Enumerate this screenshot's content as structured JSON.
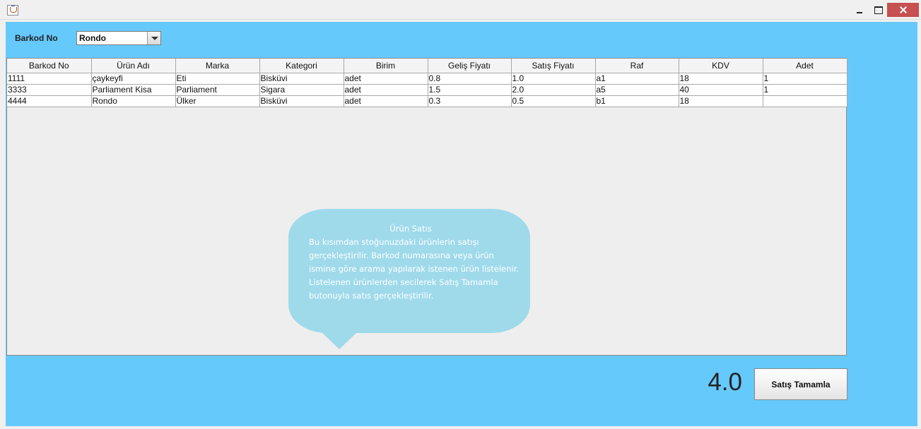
{
  "window": {
    "icon": "java-coffee-icon",
    "controls": [
      "minimize-icon",
      "maximize-icon",
      "close-icon"
    ]
  },
  "filter": {
    "label": "Barkod No",
    "selected": "Rondo"
  },
  "table": {
    "headers": [
      "Barkod No",
      "Ürün Adı",
      "Marka",
      "Kategori",
      "Birim",
      "Geliş Fiyatı",
      "Satış Fiyatı",
      "Raf",
      "KDV",
      "Adet"
    ],
    "rows": [
      [
        "1111",
        "çaykeyfi",
        "Eti",
        "Bisküvi",
        "adet",
        "0.8",
        "1.0",
        "a1",
        "18",
        "1"
      ],
      [
        "3333",
        "Parliament Kisa",
        "Parliament",
        "Sigara",
        "adet",
        "1.5",
        "2.0",
        "a5",
        "40",
        "1"
      ],
      [
        "4444",
        "Rondo",
        "Ülker",
        "Bisküvi",
        "adet",
        "0.3",
        "0.5",
        "b1",
        "18",
        ""
      ]
    ]
  },
  "tooltip": {
    "title": "Ürün Satıs",
    "body": "Bu kısımdan stoğunuzdaki ürünlerin satışı gerçekleştirilir. Barkod numarasına veya ürün ismine göre arama yapılarak istenen ürün listelenir. Listelenen ürünlerden secilerek Satış Tamamla butonuyla satıs gerçekleştirilir."
  },
  "total": "4.0",
  "complete_button": "Satış Tamamla",
  "colors": {
    "panel_background": "#66c9fb",
    "bubble": "#9fdaeb"
  }
}
